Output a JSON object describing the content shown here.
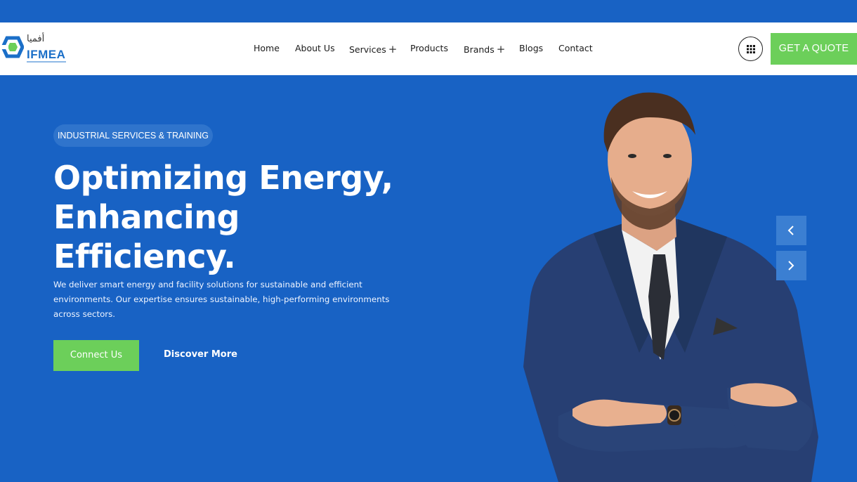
{
  "brand": {
    "logo_text": "IFMEA",
    "logo_arabic": "أفميا"
  },
  "nav": {
    "items": [
      {
        "label": "Home"
      },
      {
        "label": "About Us"
      },
      {
        "label": "Services",
        "plus": "+"
      },
      {
        "label": "Products"
      },
      {
        "label": "Brands",
        "plus": "+"
      },
      {
        "label": "Blogs"
      },
      {
        "label": "Contact"
      }
    ],
    "grid_icon": "grid-icon",
    "quote_label": "GET A QUOTE"
  },
  "hero": {
    "badge": "INDUSTRIAL SERVICES & TRAINING",
    "headline": [
      "Optimizing Energy,",
      "Enhancing",
      "Efficiency."
    ],
    "description": "We deliver smart energy and facility solutions for sustainable and efficient environments. Our expertise ensures sustainable, high-performing environments across sectors.",
    "primary_button": "Connect Us",
    "secondary_link": "Discover More",
    "prev_icon": "chevron-left-icon",
    "next_icon": "chevron-right-icon"
  },
  "colors": {
    "primary_blue": "#1862c4",
    "accent_green": "#6ccf5a",
    "white": "#ffffff"
  }
}
